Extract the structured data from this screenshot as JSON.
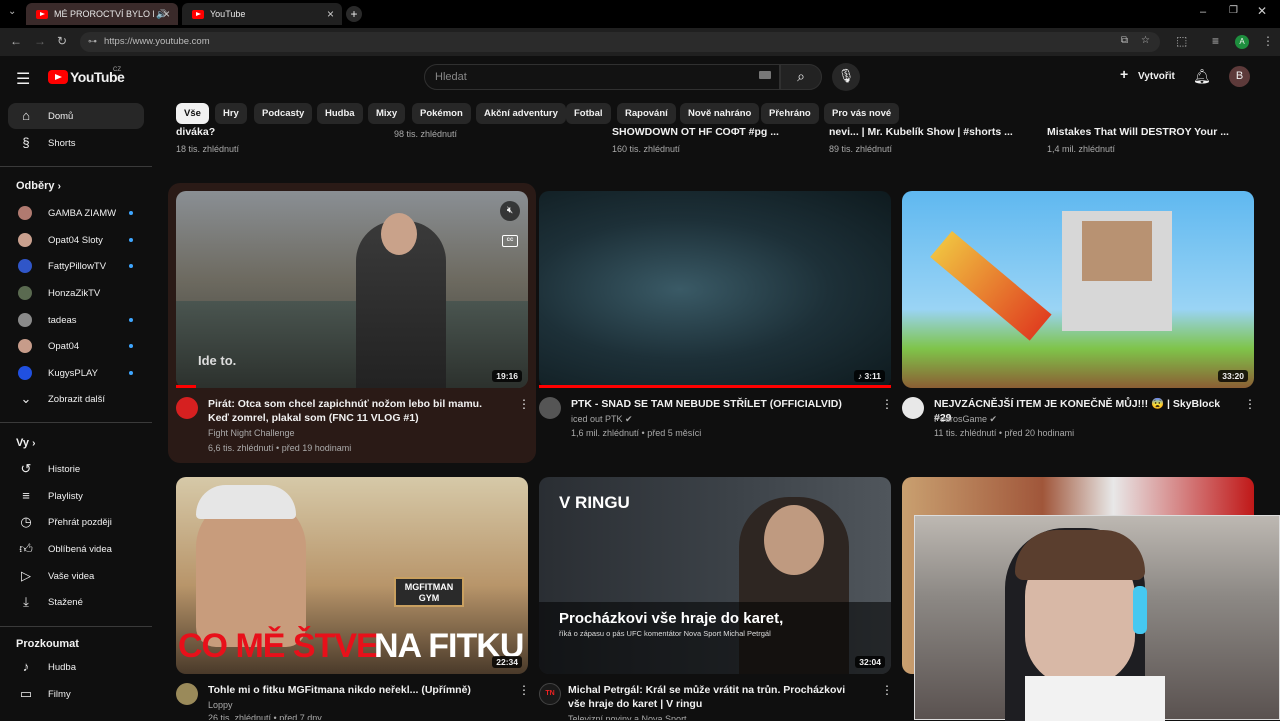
{
  "browser": {
    "tabs": [
      {
        "title": "MÉ PROROCTVÍ BYLO NAPL"
      },
      {
        "title": "YouTube"
      }
    ],
    "url": "https://www.youtube.com"
  },
  "header": {
    "logo_text": "YouTube",
    "region": "CZ",
    "search_placeholder": "Hledat",
    "create_label": "Vytvořit",
    "avatar_letter": "B"
  },
  "sidebar": {
    "main": [
      {
        "label": "Domů",
        "icon": "home-icon"
      },
      {
        "label": "Shorts",
        "icon": "shorts-icon"
      }
    ],
    "subs_title": "Odběry",
    "subs": [
      {
        "label": "GAMBA ZIAMW",
        "color": "#b07a70"
      },
      {
        "label": "Opat04 Sloty",
        "color": "#c9a08e"
      },
      {
        "label": "FattyPillowTV",
        "color": "#3056c8"
      },
      {
        "label": "HonzaZikTV",
        "color": "#5a6a50"
      },
      {
        "label": "tadeas",
        "color": "#8a8a8a"
      },
      {
        "label": "Opat04",
        "color": "#c79c8a"
      },
      {
        "label": "KugysPLAY",
        "color": "#2050e0"
      }
    ],
    "show_more": "Zobrazit další",
    "you_title": "Vy",
    "you": [
      {
        "label": "Historie",
        "icon": "history-icon"
      },
      {
        "label": "Playlisty",
        "icon": "playlist-icon"
      },
      {
        "label": "Přehrát později",
        "icon": "watch-later-icon"
      },
      {
        "label": "Oblíbená videa",
        "icon": "like-icon"
      },
      {
        "label": "Vaše videa",
        "icon": "your-videos-icon"
      },
      {
        "label": "Stažené",
        "icon": "download-icon"
      }
    ],
    "explore_title": "Prozkoumat",
    "explore": [
      {
        "label": "Hudba",
        "icon": "music-icon"
      },
      {
        "label": "Filmy",
        "icon": "film-icon"
      }
    ]
  },
  "chips": [
    "Vše",
    "Hry",
    "Podcasty",
    "Hudba",
    "Mixy",
    "Pokémon",
    "Akční adventury",
    "Fotbal",
    "Rapování",
    "Nově nahráno",
    "Přehráno",
    "Pro vás nové"
  ],
  "top_row": [
    {
      "title": "diváka?",
      "meta": "18 tis. zhlédnutí"
    },
    {
      "title": "",
      "meta": "98 tis. zhlédnutí"
    },
    {
      "title": "SHOWDOWN OT HF СОФТ #pg ...",
      "meta": "160 tis. zhlédnutí"
    },
    {
      "title": "nevi... | Mr. Kubelík Show | #shorts ...",
      "meta": "89 tis. zhlédnutí"
    },
    {
      "title": "Mistakes That Will DESTROY Your ...",
      "meta": "1,4 mil. zhlédnutí"
    }
  ],
  "videos": [
    {
      "title": "Pirát: Otca som chcel zapichnúť nožom lebo bil mamu. Keď zomrel, plakal som (FNC 11 VLOG #1)",
      "channel": "Fight Night Challenge",
      "meta": "6,6 tis. zhlédnutí • před 19 hodinami",
      "duration": "19:16",
      "caption": "Ide to."
    },
    {
      "title": "PTK - SNAD SE TAM NEBUDE STŘÍLET (OFFICIALVID)",
      "channel": "iced out PTK",
      "meta": "1,6 mil. zhlédnutí • před 5 měsíci",
      "duration": "3:11"
    },
    {
      "title": "NEJVZÁCNĚJŠÍ ITEM JE KONEČNĚ MŮJ!!! 😨 | SkyBlock #29",
      "channel": "PedrosGame",
      "meta": "11 tis. zhlédnutí • před 20 hodinami",
      "duration": "33:20"
    },
    {
      "title": "Tohle mi o fitku MGFitmana nikdo neřekl... (Upřímně)",
      "channel": "Loppy",
      "meta": "26 tis. zhlédnutí • před 7 dny",
      "duration": "22:34",
      "thumb_text_a": "CO MĚ ŠTVE",
      "thumb_text_b": "NA FITKU",
      "sign": "MGFITMAN GYM"
    },
    {
      "title": "Michal Petrgál: Král se může vrátit na trůn. Procházkovi vše hraje do karet | V ringu",
      "channel": "Televizní noviny a Nova Sport",
      "meta": "",
      "duration": "32:04",
      "thumb_label": "V RINGU",
      "thumb_head": "Procházkovi vše hraje do karet,",
      "thumb_sub": "říká o zápasu o pás UFC komentátor Nova Sport Michal Petrgál"
    }
  ]
}
